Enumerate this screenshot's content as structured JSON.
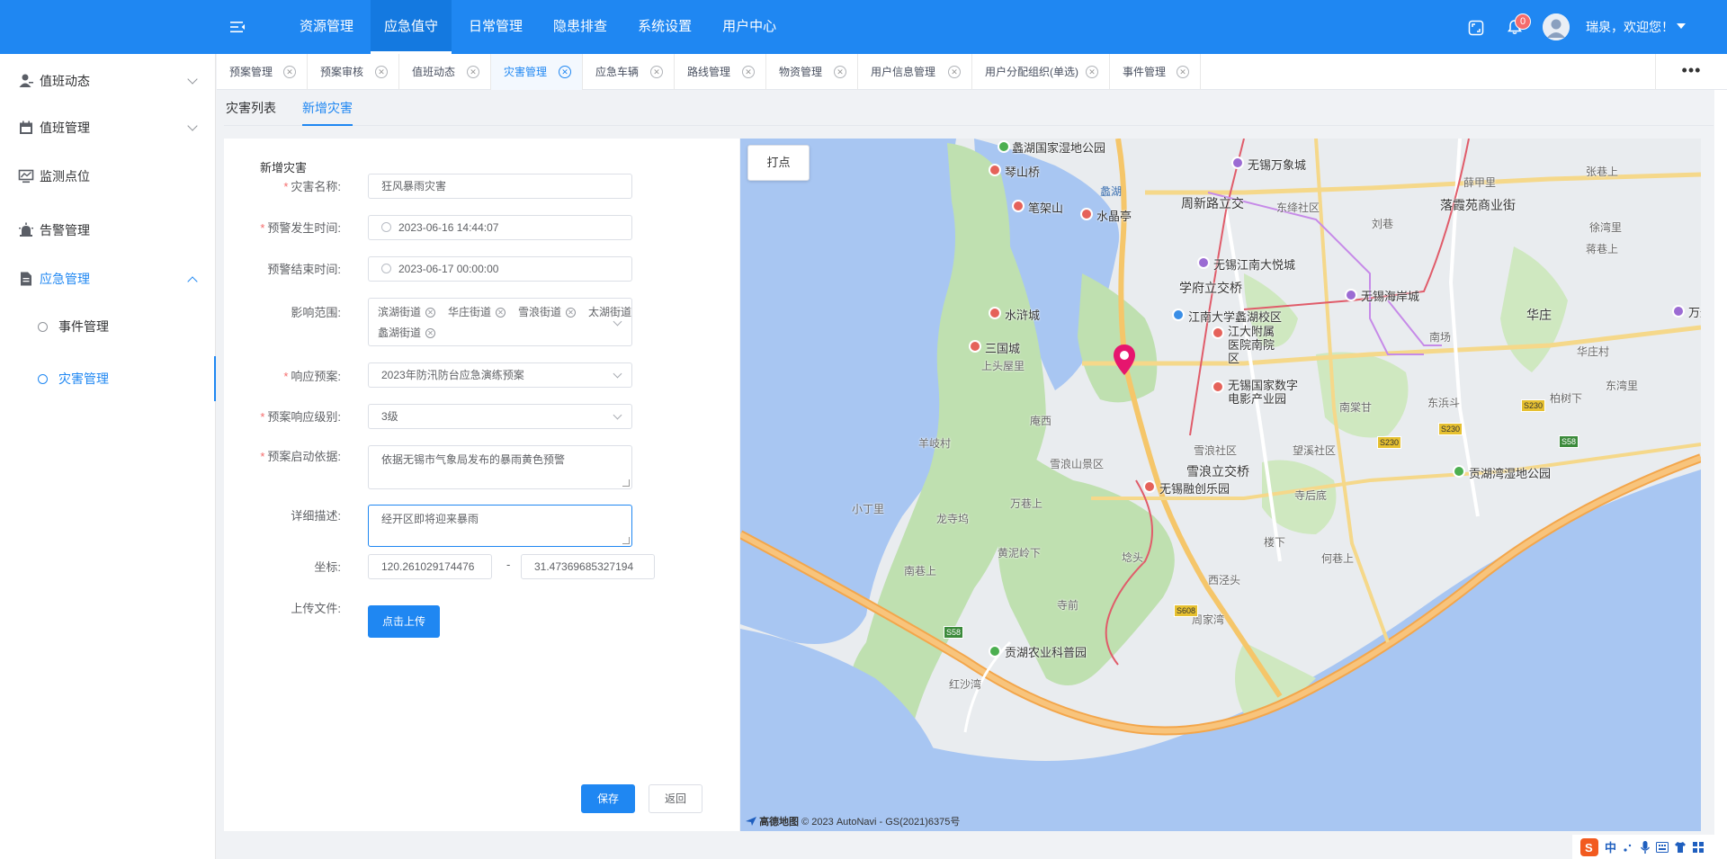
{
  "header": {
    "nav": [
      "资源管理",
      "应急值守",
      "日常管理",
      "隐患排查",
      "系统设置",
      "用户中心"
    ],
    "active_nav": "应急值守",
    "notifications": "0",
    "welcome": "瑞泉，欢迎您！"
  },
  "sidebar": {
    "items": [
      {
        "label": "值班动态"
      },
      {
        "label": "值班管理"
      },
      {
        "label": "监测点位"
      },
      {
        "label": "告警管理"
      },
      {
        "label": "应急管理"
      }
    ],
    "sub_items": [
      {
        "label": "事件管理"
      },
      {
        "label": "灾害管理"
      }
    ]
  },
  "tabs": [
    {
      "label": "预案管理"
    },
    {
      "label": "预案审核"
    },
    {
      "label": "值班动态"
    },
    {
      "label": "灾害管理"
    },
    {
      "label": "应急车辆"
    },
    {
      "label": "路线管理"
    },
    {
      "label": "物资管理"
    },
    {
      "label": "用户信息管理"
    },
    {
      "label": "用户分配组织(单选)"
    },
    {
      "label": "事件管理"
    }
  ],
  "tabs_more": "•••",
  "subtabs": [
    "灾害列表",
    "新增灾害"
  ],
  "form": {
    "title": "新增灾害",
    "name_label": "灾害名称:",
    "name_value": "狂风暴雨灾害",
    "start_label": "预警发生时间:",
    "start_value": "2023-06-16 14:44:07",
    "end_label": "预警结束时间:",
    "end_value": "2023-06-17 00:00:00",
    "scope_label": "影响范围:",
    "scope_tags": [
      "滨湖街道",
      "华庄街道",
      "雪浪街道",
      "太湖街道",
      "蠡湖街道"
    ],
    "plan_label": "响应预案:",
    "plan_value": "2023年防汛防台应急演练预案",
    "level_label": "预案响应级别:",
    "level_value": "3级",
    "basis_label": "预案启动依据:",
    "basis_value": "依据无锡市气象局发布的暴雨黄色预警",
    "detail_label": "详细描述:",
    "detail_value": "经开区即将迎来暴雨",
    "coord_label": "坐标:",
    "lng": "120.261029174476",
    "coord_sep": "-",
    "lat": "31.47369685327194",
    "upload_label": "上传文件:",
    "upload_button": "点击上传",
    "save_button": "保存",
    "back_button": "返回"
  },
  "map": {
    "mark_button": "打点",
    "labels": [
      {
        "text": "蠡湖国家湿地公园"
      },
      {
        "text": "无锡万象城"
      },
      {
        "text": "琴山桥"
      },
      {
        "text": "蠡湖"
      },
      {
        "text": "笔架山"
      },
      {
        "text": "水晶亭"
      },
      {
        "text": "周新路立交"
      },
      {
        "text": "东绛社区"
      },
      {
        "text": "刘巷"
      },
      {
        "text": "落霞苑商业街"
      },
      {
        "text": "张巷上"
      },
      {
        "text": "薛甲里"
      },
      {
        "text": "徐湾里"
      },
      {
        "text": "蒋巷上"
      },
      {
        "text": "无锡江南大悦城"
      },
      {
        "text": "学府立交桥"
      },
      {
        "text": "无锡海岸城"
      },
      {
        "text": "水浒城"
      },
      {
        "text": "江南大学蠡湖校区"
      },
      {
        "text": "江大附属医院南院区"
      },
      {
        "text": "华庄"
      },
      {
        "text": "三国城"
      },
      {
        "text": "南场"
      },
      {
        "text": "华庄村"
      },
      {
        "text": "上头屋里"
      },
      {
        "text": "无锡国家数字电影产业园"
      },
      {
        "text": "南棠甘"
      },
      {
        "text": "东浜斗"
      },
      {
        "text": "柏树下"
      },
      {
        "text": "东湾里"
      },
      {
        "text": "庵西"
      },
      {
        "text": "羊岐村"
      },
      {
        "text": "雪浪社区"
      },
      {
        "text": "望溪社区"
      },
      {
        "text": "雪浪山景区"
      },
      {
        "text": "雪浪立交桥"
      },
      {
        "text": "贡湖湾湿地公园"
      },
      {
        "text": "无锡融创乐园"
      },
      {
        "text": "寺后底"
      },
      {
        "text": "小丁里"
      },
      {
        "text": "万巷上"
      },
      {
        "text": "龙寺坞"
      },
      {
        "text": "黄泥岭下"
      },
      {
        "text": "埝头"
      },
      {
        "text": "楼下"
      },
      {
        "text": "何巷上"
      },
      {
        "text": "南巷上"
      },
      {
        "text": "西泾头"
      },
      {
        "text": "寺前"
      },
      {
        "text": "周家湾"
      },
      {
        "text": "贡湖农业科普园"
      },
      {
        "text": "红沙湾"
      },
      {
        "text": "万达"
      }
    ],
    "road_signs": [
      "S230",
      "S230",
      "S230",
      "S58",
      "S58",
      "S608"
    ],
    "logo": "高德地图",
    "copyright": "© 2023 AutoNavi - GS(2021)6375号"
  },
  "ime": {
    "text": "中"
  },
  "colors": {
    "primary": "#1f87f2",
    "danger": "#f56c6c",
    "marker": "#e6166e"
  }
}
